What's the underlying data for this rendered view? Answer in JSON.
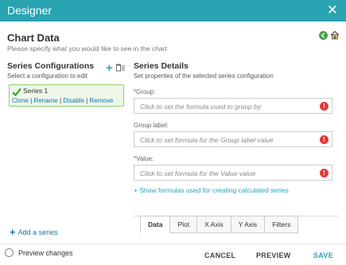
{
  "window": {
    "title": "Designer",
    "close_glyph": "✕"
  },
  "header": {
    "title": "Chart Data",
    "subtitle": "Please specify what you would like to see in the chart",
    "icons": [
      "back-arrow-icon",
      "home-icon"
    ]
  },
  "series_config": {
    "title": "Series Configurations",
    "subtitle": "Select a configuration to edit",
    "add_glyph": "+",
    "series": [
      {
        "name": "Series 1",
        "actions": [
          "Clone",
          "Rename",
          "Disable",
          "Remove"
        ],
        "separator": "|"
      }
    ],
    "add_series_label": "Add a series",
    "add_series_glyph": "+"
  },
  "series_details": {
    "title": "Series Details",
    "subtitle": "Set properties of the selected series configuration",
    "fields": [
      {
        "label": "*Group:",
        "placeholder": "Click to set the formula used to group by",
        "error_glyph": "!"
      },
      {
        "label": "Group label:",
        "placeholder": "Click to set formula for the Group label value",
        "error_glyph": "!"
      },
      {
        "label": "*Value:",
        "placeholder": "Click to set formula for the Value value",
        "error_glyph": "!"
      }
    ],
    "calc_link": "+ Show formulas used for creating calculated series"
  },
  "tabs": [
    {
      "label": "Data",
      "active": true
    },
    {
      "label": "Plot",
      "active": false
    },
    {
      "label": "X Axis",
      "active": false
    },
    {
      "label": "Y Axis",
      "active": false
    },
    {
      "label": "Filters",
      "active": false
    }
  ],
  "footer": {
    "preview_changes": "Preview changes",
    "cancel": "CANCEL",
    "preview": "PREVIEW",
    "save": "SAVE"
  },
  "colors": {
    "accent": "#2aa3b3",
    "link": "#1a73a8",
    "series_card_bg": "#eef7e8",
    "series_card_border": "#8fcf6a",
    "error": "#e53935",
    "back_icon": "#43a047"
  }
}
